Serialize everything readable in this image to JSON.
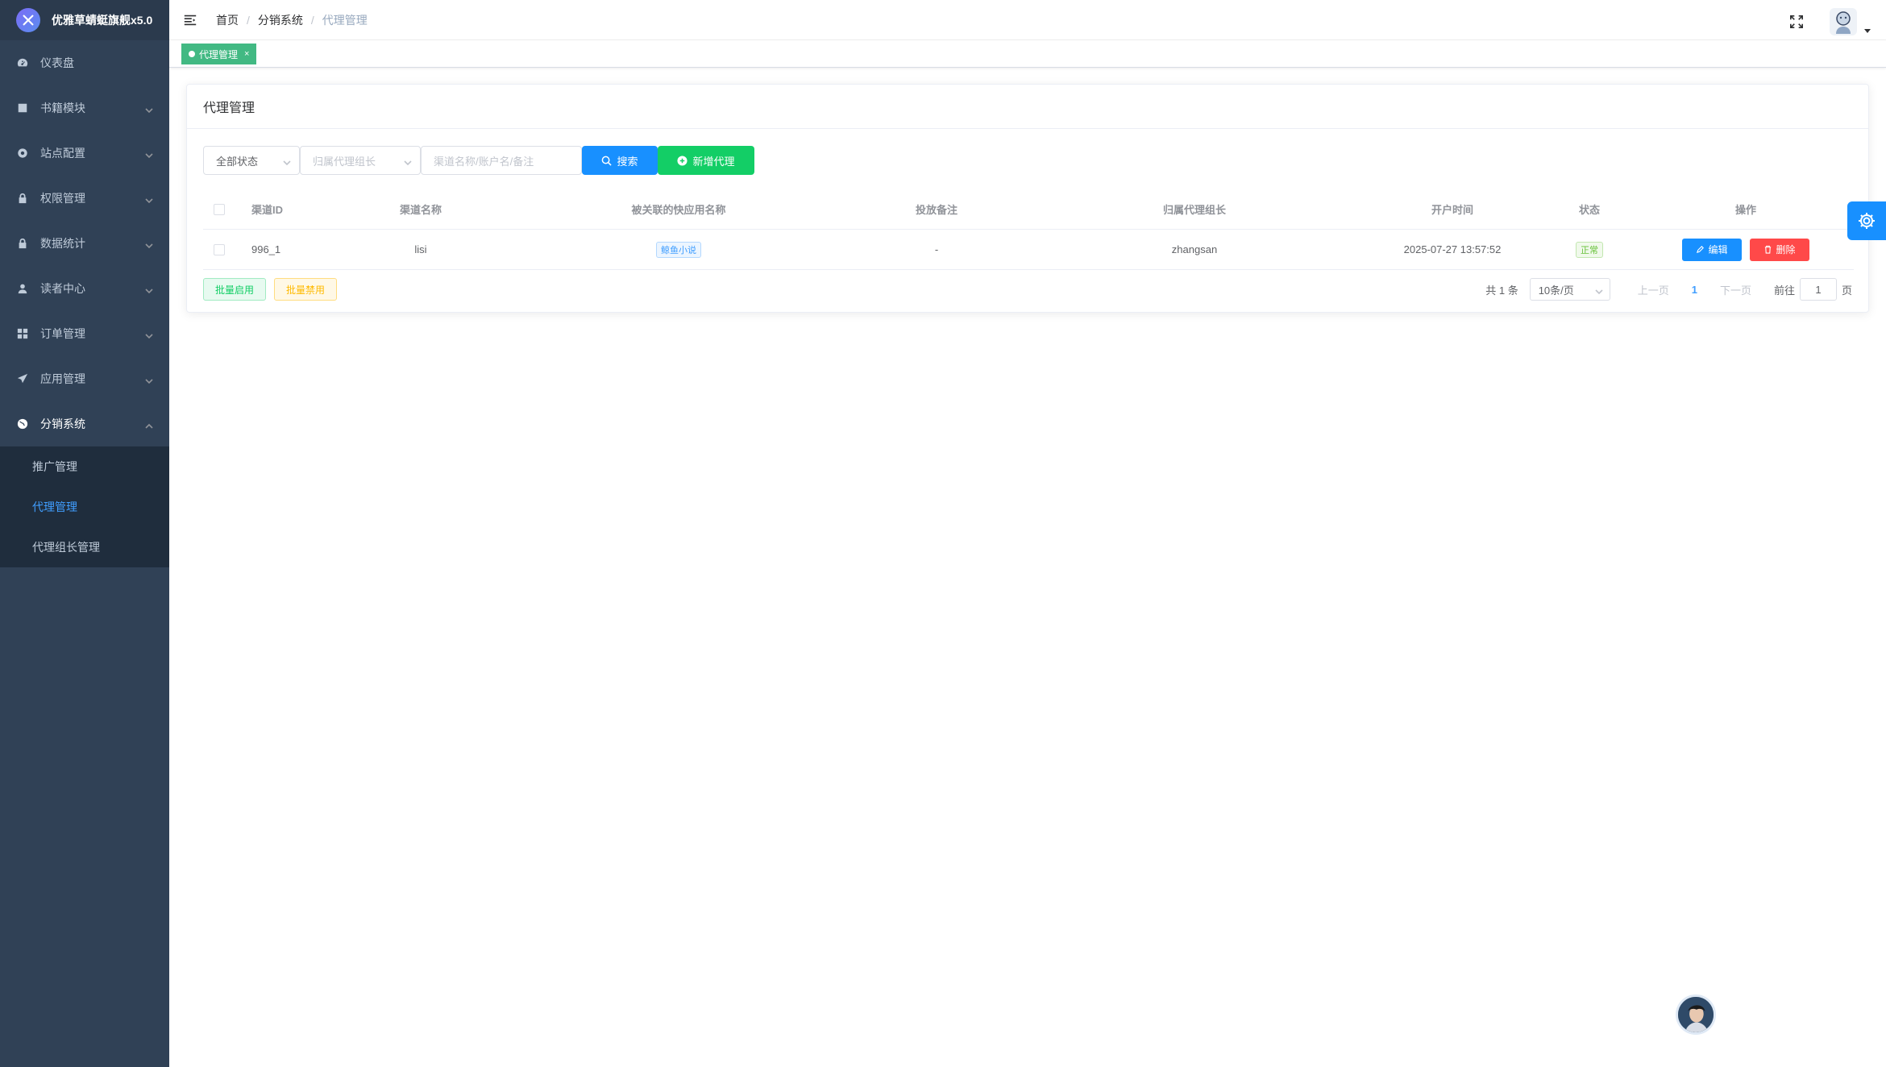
{
  "app": {
    "title": "优雅草蜻蜓旗舰x5.0"
  },
  "sidebar": {
    "items": [
      {
        "label": "仪表盘",
        "icon": "dashboard-icon"
      },
      {
        "label": "书籍模块",
        "icon": "book-icon"
      },
      {
        "label": "站点配置",
        "icon": "site-config-icon"
      },
      {
        "label": "权限管理",
        "icon": "lock-icon"
      },
      {
        "label": "数据统计",
        "icon": "lock-icon"
      },
      {
        "label": "读者中心",
        "icon": "user-icon"
      },
      {
        "label": "订单管理",
        "icon": "grid-icon"
      },
      {
        "label": "应用管理",
        "icon": "send-icon"
      },
      {
        "label": "分销系统",
        "icon": "globe-icon"
      }
    ],
    "submenu": [
      {
        "label": "推广管理"
      },
      {
        "label": "代理管理"
      },
      {
        "label": "代理组长管理"
      }
    ]
  },
  "breadcrumb": {
    "home": "首页",
    "parent": "分销系统",
    "current": "代理管理"
  },
  "tags": {
    "active": "代理管理",
    "close": "×"
  },
  "card": {
    "title": "代理管理"
  },
  "filters": {
    "status_value": "全部状态",
    "leader_placeholder": "归属代理组长",
    "search_placeholder": "渠道名称/账户名/备注",
    "search_button": "搜索",
    "add_button": "新增代理"
  },
  "table": {
    "headers": {
      "id": "渠道ID",
      "name": "渠道名称",
      "app": "被关联的快应用名称",
      "remark": "投放备注",
      "leader": "归属代理组长",
      "time": "开户时间",
      "status": "状态",
      "ops": "操作"
    },
    "rows": [
      {
        "id": "996_1",
        "name": "lisi",
        "app": "鲸鱼小说",
        "remark": "-",
        "leader": "zhangsan",
        "time": "2025-07-27 13:57:52",
        "status": "正常",
        "edit": "编辑",
        "delete": "删除"
      }
    ]
  },
  "batch": {
    "enable": "批量启用",
    "disable": "批量禁用"
  },
  "pagination": {
    "total": "共 1 条",
    "page_size": "10条/页",
    "prev": "上一页",
    "current": "1",
    "next": "下一页",
    "goto_label": "前往",
    "goto_value": "1",
    "page_suffix": "页"
  },
  "colors": {
    "sidebar_bg": "#304156",
    "accent": "#1890ff",
    "success": "#13ce66",
    "danger": "#ff4949",
    "tag_green": "#42b983"
  }
}
